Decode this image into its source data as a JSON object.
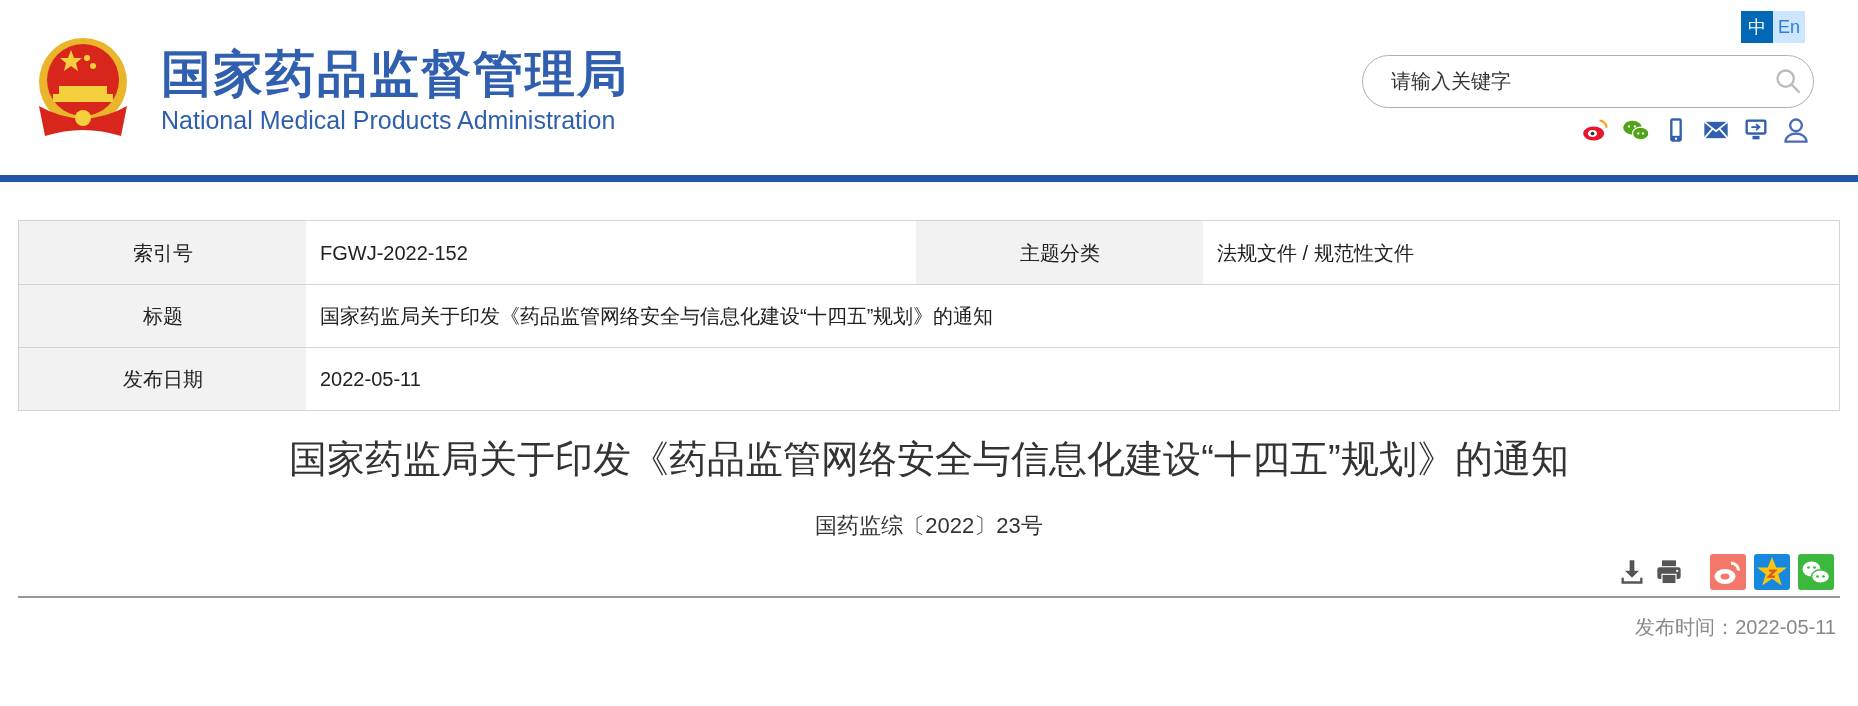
{
  "header": {
    "title": "国家药品监督管理局",
    "subtitle": "National Medical Products Administration",
    "languages": [
      {
        "label": "中",
        "selected": true
      },
      {
        "label": "En",
        "selected": false
      }
    ],
    "search": {
      "placeholder": "请输入关键字"
    }
  },
  "info_table": {
    "rows": [
      {
        "cells": [
          {
            "label": "索引号",
            "value": "FGWJ-2022-152"
          },
          {
            "label": "主题分类",
            "value": "法规文件 / 规范性文件"
          }
        ]
      },
      {
        "cells": [
          {
            "label": "标题",
            "value": "国家药监局关于印发《药品监管网络安全与信息化建设“十四五”规划》的通知"
          }
        ]
      },
      {
        "cells": [
          {
            "label": "发布日期",
            "value": "2022-05-11"
          }
        ]
      }
    ]
  },
  "article": {
    "title": "国家药监局关于印发《药品监管网络安全与信息化建设“十四五”规划》的通知",
    "doc_number": "国药监综〔2022〕23号",
    "publish_time": "发布时间：2022-05-11"
  }
}
